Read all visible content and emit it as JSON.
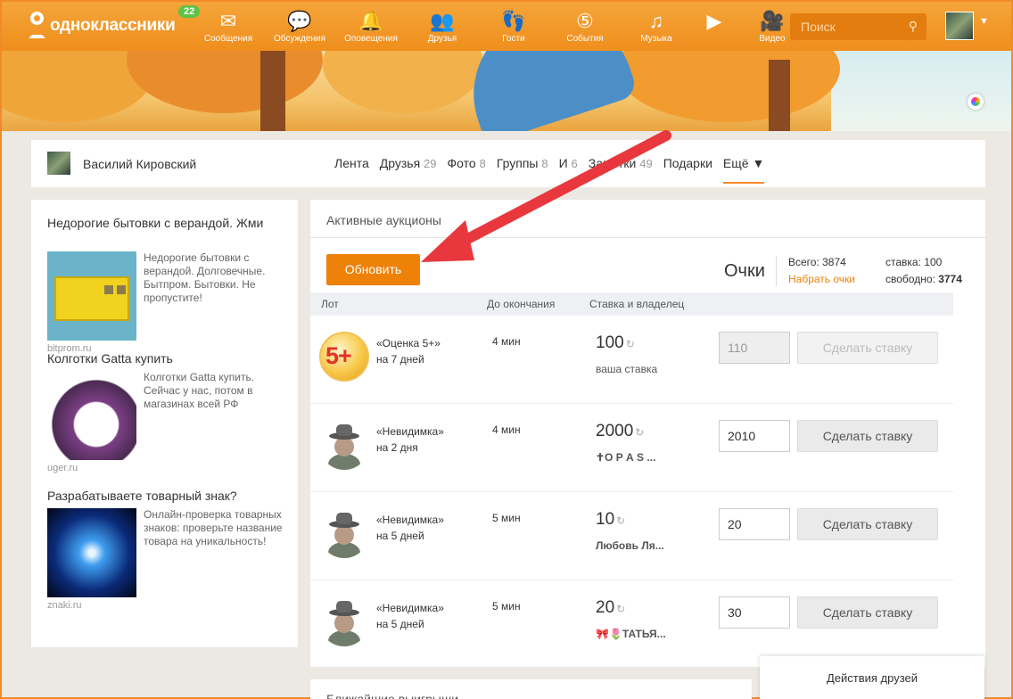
{
  "app": {
    "logo_text": "одноклассники",
    "notifications_badge": "22",
    "brand_color": "#f39a2c"
  },
  "nav": [
    {
      "label": "Сообщения",
      "icon": "envelope-icon"
    },
    {
      "label": "Обсуждения",
      "icon": "chat-bubbles-icon"
    },
    {
      "label": "Оповещения",
      "icon": "bell-icon"
    },
    {
      "label": "Друзья",
      "icon": "friends-icon"
    },
    {
      "label": "Гости",
      "icon": "footprints-icon"
    },
    {
      "label": "События",
      "icon": "events-5-icon"
    },
    {
      "label": "Музыка",
      "icon": "music-note-icon"
    },
    {
      "label": "",
      "icon": "play-icon"
    },
    {
      "label": "Видео",
      "icon": "video-camera-icon"
    }
  ],
  "search": {
    "placeholder": "Поиск"
  },
  "profile": {
    "name": "Василий Кировский",
    "tabs": [
      {
        "label": "Лента",
        "count": ""
      },
      {
        "label": "Друзья",
        "count": "29"
      },
      {
        "label": "Фото",
        "count": "8"
      },
      {
        "label": "Группы",
        "count": "8"
      },
      {
        "label": "И",
        "count": "6"
      },
      {
        "label": "Заметки",
        "count": "49"
      },
      {
        "label": "Подарки",
        "count": ""
      },
      {
        "label": "Ещё ▼",
        "count": ""
      }
    ]
  },
  "ads": [
    {
      "title": "Недорогие бытовки с верандой. Жми",
      "text": "Недорогие бытовки с верандой. Долговечные. Бытпром. Бытовки. Не пропустите!",
      "domain": "bitprom.ru"
    },
    {
      "title": "Колготки Gatta купить",
      "text": "Колготки Gatta купить. Сейчас у нас, потом в магазинах всей РФ",
      "domain": "uger.ru"
    },
    {
      "title": "Разрабатываете товарный знак?",
      "text": "Онлайн-проверка товарных знаков: проверьте название товара на уникальность!",
      "domain": "znaki.ru"
    }
  ],
  "auctions": {
    "title": "Активные аукционы",
    "refresh_label": "Обновить",
    "points_label": "Очки",
    "total_label": "Всего: 3874",
    "buy_points_label": "Набрать очки",
    "stake_label": "ставка: 100",
    "free_label": "свободно:",
    "free_value": "3774",
    "columns": [
      "Лот",
      "До окончания",
      "Ставка и владелец"
    ],
    "rows": [
      {
        "name": "«Оценка 5+»",
        "duration": "на 7 дней",
        "time_left": "4 мин",
        "bid": "100",
        "owner": "ваша ставка",
        "input": "110",
        "button": "Сделать ставку",
        "icon": "grade-5plus-icon",
        "disabled": true
      },
      {
        "name": "«Невидимка»",
        "duration": "на 2 дня",
        "time_left": "4 мин",
        "bid": "2000",
        "owner": "✝О Р А S ...",
        "input": "2010",
        "button": "Сделать ставку",
        "icon": "invisible-man-icon",
        "disabled": false
      },
      {
        "name": "«Невидимка»",
        "duration": "на 5 дней",
        "time_left": "5 мин",
        "bid": "10",
        "owner": "Любовь Ля...",
        "input": "20",
        "button": "Сделать ставку",
        "icon": "invisible-man-icon",
        "disabled": false
      },
      {
        "name": "«Невидимка»",
        "duration": "на 5 дней",
        "time_left": "5 мин",
        "bid": "20",
        "owner": "🎀🌷ТАТЬЯ...",
        "input": "30",
        "button": "Сделать ставку",
        "icon": "invisible-man-icon",
        "disabled": false
      }
    ]
  },
  "bottom": {
    "next_block_title": "Ближайшие выигрыши",
    "friends_actions": "Действия друзей"
  },
  "annotation": {
    "arrow_color": "#e8383d"
  }
}
